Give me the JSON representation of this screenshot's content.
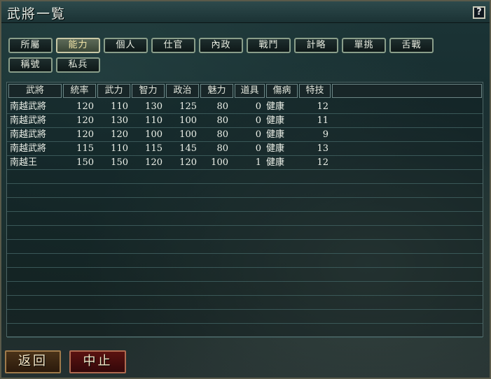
{
  "window": {
    "title": "武將一覧",
    "help_label": "?"
  },
  "tabs": [
    {
      "label": "所屬",
      "active": false
    },
    {
      "label": "能力",
      "active": true
    },
    {
      "label": "個人",
      "active": false
    },
    {
      "label": "仕官",
      "active": false
    },
    {
      "label": "內政",
      "active": false
    },
    {
      "label": "戰鬥",
      "active": false
    },
    {
      "label": "計略",
      "active": false
    },
    {
      "label": "單挑",
      "active": false
    },
    {
      "label": "舌戰",
      "active": false
    },
    {
      "label": "稱號",
      "active": false
    },
    {
      "label": "私兵",
      "active": false
    }
  ],
  "table": {
    "headers": [
      "武將",
      "統率",
      "武力",
      "智力",
      "政治",
      "魅力",
      "道具",
      "傷病",
      "特技"
    ],
    "rows": [
      [
        "南越武將",
        "120",
        "110",
        "130",
        "125",
        "80",
        "0",
        "健康",
        "12"
      ],
      [
        "南越武將",
        "120",
        "130",
        "110",
        "100",
        "80",
        "0",
        "健康",
        "11"
      ],
      [
        "南越武將",
        "120",
        "120",
        "100",
        "100",
        "80",
        "0",
        "健康",
        "9"
      ],
      [
        "南越武將",
        "115",
        "110",
        "115",
        "145",
        "80",
        "0",
        "健康",
        "13"
      ],
      [
        "南越王",
        "150",
        "150",
        "120",
        "120",
        "100",
        "1",
        "健康",
        "12"
      ]
    ]
  },
  "buttons": {
    "back": "返回",
    "stop": "中止"
  }
}
